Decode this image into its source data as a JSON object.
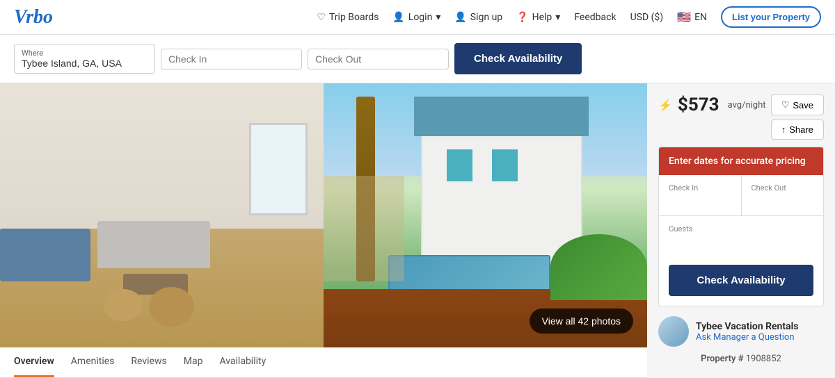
{
  "logo": {
    "text": "Vrbo"
  },
  "header": {
    "nav": [
      {
        "id": "trip-boards",
        "label": "Trip Boards",
        "icon": "heart"
      },
      {
        "id": "login",
        "label": "Login",
        "icon": "user",
        "hasDropdown": true
      },
      {
        "id": "sign-up",
        "label": "Sign up",
        "icon": "user-add"
      },
      {
        "id": "help",
        "label": "Help",
        "icon": "question",
        "hasDropdown": true
      },
      {
        "id": "feedback",
        "label": "Feedback"
      },
      {
        "id": "currency",
        "label": "USD ($)"
      },
      {
        "id": "language",
        "label": "EN",
        "icon": "flag"
      }
    ],
    "list_property": "List your Property"
  },
  "search_bar": {
    "where_label": "Where",
    "where_value": "Tybee Island, GA, USA",
    "checkin_label": "Check In",
    "checkin_placeholder": "Check In",
    "checkout_label": "Check Out",
    "checkout_placeholder": "Check Out",
    "check_avail_label": "Check Availability"
  },
  "gallery": {
    "view_all_label": "View all 42 photos",
    "photo_count": 42
  },
  "sidebar": {
    "price": "$573",
    "per_night": "avg/night",
    "save_label": "Save",
    "share_label": "Share",
    "booking_widget": {
      "dates_banner": "Enter dates for accurate pricing",
      "checkin_label": "Check In",
      "checkout_label": "Check Out",
      "guests_label": "Guests",
      "check_avail_label": "Check Availability"
    },
    "manager": {
      "name": "Tybee Vacation Rentals",
      "link": "Ask Manager a Question"
    },
    "property_label": "Property #",
    "property_number": "1908852"
  },
  "tabs": [
    {
      "id": "overview",
      "label": "Overview",
      "active": true
    },
    {
      "id": "amenities",
      "label": "Amenities"
    },
    {
      "id": "reviews",
      "label": "Reviews"
    },
    {
      "id": "map",
      "label": "Map"
    },
    {
      "id": "availability",
      "label": "Availability"
    }
  ]
}
